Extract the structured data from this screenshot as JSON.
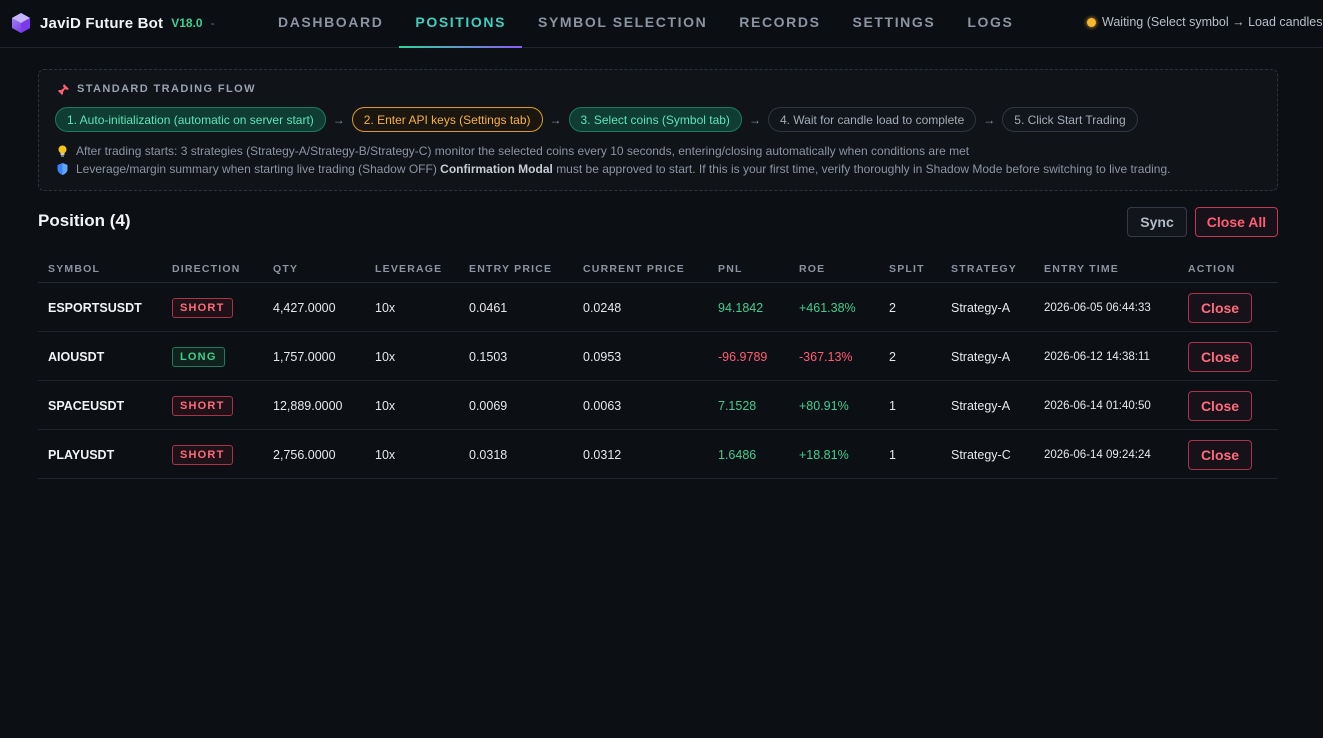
{
  "app": {
    "name": "JaviD Future Bot",
    "version": "V18.0",
    "separator": "-",
    "status": "Waiting (Select symbol → Load candles"
  },
  "nav": [
    {
      "label": "DASHBOARD",
      "active": false
    },
    {
      "label": "POSITIONS",
      "active": true
    },
    {
      "label": "SYMBOL SELECTION",
      "active": false
    },
    {
      "label": "RECORDS",
      "active": false
    },
    {
      "label": "SETTINGS",
      "active": false
    },
    {
      "label": "LOGS",
      "active": false
    }
  ],
  "flow": {
    "title": "STANDARD TRADING FLOW",
    "steps": [
      {
        "label": "1. Auto-initialization (automatic on server start)",
        "style": "green"
      },
      {
        "label": "2. Enter API keys (Settings tab)",
        "style": "orange"
      },
      {
        "label": "3. Select coins (Symbol tab)",
        "style": "green"
      },
      {
        "label": "4. Wait for candle load to complete",
        "style": "grey"
      },
      {
        "label": "5. Click Start Trading",
        "style": "grey"
      }
    ],
    "arrow": "→",
    "note1": "After trading starts: 3 strategies (Strategy-A/Strategy-B/Strategy-C) monitor the selected coins every 10 seconds, entering/closing automatically when conditions are met",
    "note2_before": "Leverage/margin summary when starting live trading (Shadow OFF)",
    "note2_bold": "Confirmation Modal",
    "note2_after": "must be approved to start. If this is your first time, verify thoroughly in Shadow Mode before switching to live trading."
  },
  "positions": {
    "title": "Position (4)",
    "sync_label": "Sync",
    "close_all_label": "Close All",
    "columns": [
      "SYMBOL",
      "DIRECTION",
      "QTY",
      "LEVERAGE",
      "ENTRY PRICE",
      "CURRENT PRICE",
      "PNL",
      "ROE",
      "SPLIT",
      "STRATEGY",
      "ENTRY TIME",
      "ACTION"
    ],
    "rows": [
      {
        "symbol": "ESPORTSUSDT",
        "direction": "SHORT",
        "qty": "4,427.0000",
        "leverage": "10x",
        "entry": "0.0461",
        "current": "0.0248",
        "pnl": "94.1842",
        "roe": "+461.38%",
        "split": "2",
        "strategy": "Strategy-A",
        "time": "2026-06-05 06:44:33",
        "action": "Close"
      },
      {
        "symbol": "AIOUSDT",
        "direction": "LONG",
        "qty": "1,757.0000",
        "leverage": "10x",
        "entry": "0.1503",
        "current": "0.0953",
        "pnl": "-96.9789",
        "roe": "-367.13%",
        "split": "2",
        "strategy": "Strategy-A",
        "time": "2026-06-12 14:38:11",
        "action": "Close"
      },
      {
        "symbol": "SPACEUSDT",
        "direction": "SHORT",
        "qty": "12,889.0000",
        "leverage": "10x",
        "entry": "0.0069",
        "current": "0.0063",
        "pnl": "7.1528",
        "roe": "+80.91%",
        "split": "1",
        "strategy": "Strategy-A",
        "time": "2026-06-14 01:40:50",
        "action": "Close"
      },
      {
        "symbol": "PLAYUSDT",
        "direction": "SHORT",
        "qty": "2,756.0000",
        "leverage": "10x",
        "entry": "0.0318",
        "current": "0.0312",
        "pnl": "1.6486",
        "roe": "+18.81%",
        "split": "1",
        "strategy": "Strategy-C",
        "time": "2026-06-14 09:24:24",
        "action": "Close"
      }
    ]
  },
  "colors": {
    "accent": "#3ecfc0",
    "positive": "#3ecf8e",
    "negative": "#ff5d73",
    "status_waiting": "#f5b82e"
  }
}
